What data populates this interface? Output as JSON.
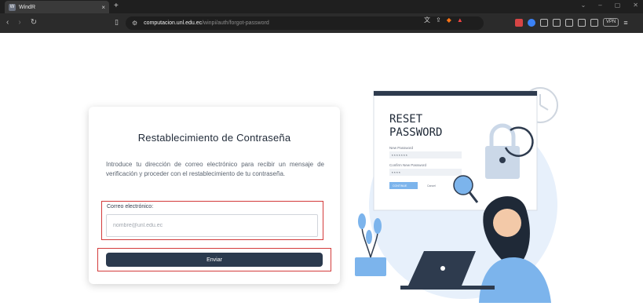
{
  "browser": {
    "tab_title": "WindR",
    "tab_favicon": "W",
    "tab_close": "×",
    "new_tab": "+",
    "url_host": "computacion.unl.edu.ec",
    "url_path": "/winpi/auth/forgot-password",
    "vpn_label": "VPN",
    "accent_colors": {
      "chrome_bg": "#1f1f1f",
      "address_bg": "#2b2b2b"
    }
  },
  "form": {
    "title": "Restablecimiento de Contraseña",
    "description": "Introduce tu dirección de correo electrónico para recibir un mensaje de verificación y proceder con el restablecimiento de tu contraseña.",
    "email_label": "Correo electrónico:",
    "email_placeholder": "nombre@unl.edu.ec",
    "email_value": "",
    "submit_label": "Enviar",
    "highlight_color": "#d33a3a",
    "button_color": "#2b3a4e"
  },
  "illustration": {
    "heading_line1": "RESET",
    "heading_line2": "PASSWORD",
    "new_password_label": "New Password",
    "new_password_mask": "* * * * * * *",
    "confirm_label": "Confirm New Password",
    "confirm_mask": "* * * *",
    "continue_label": "CONTINUE",
    "cancel_label": "Cancel"
  }
}
